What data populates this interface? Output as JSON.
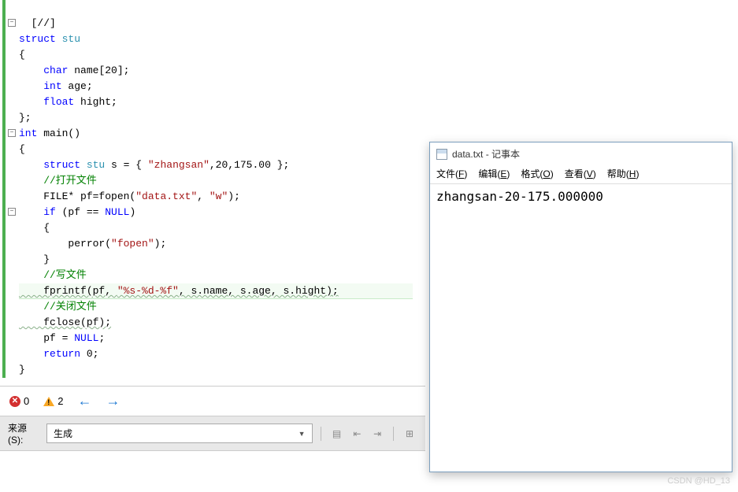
{
  "code": {
    "l1": "  [//]",
    "l2_kw": "struct",
    "l2_name": " stu",
    "l3": "{",
    "l4_a": "    ",
    "l4_kw": "char",
    "l4_b": " name[20];",
    "l5_a": "    ",
    "l5_kw": "int",
    "l5_b": " age;",
    "l6_a": "    ",
    "l6_kw": "float",
    "l6_b": " hight;",
    "l7": "};",
    "l8_kw": "int",
    "l8_b": " main()",
    "l9": "{",
    "l10_a": "    ",
    "l10_kw": "struct",
    "l10_name": " stu",
    "l10_b": " s = { ",
    "l10_str": "\"zhangsan\"",
    "l10_c": ",20,175.00 };",
    "l11_c": "    //打开文件",
    "l12_a": "    FILE* pf=fopen(",
    "l12_s1": "\"data.txt\"",
    "l12_b": ", ",
    "l12_s2": "\"w\"",
    "l12_c": ");",
    "l13_a": "    ",
    "l13_kw": "if",
    "l13_b": " (pf == ",
    "l13_n": "NULL",
    "l13_c": ")",
    "l14": "    {",
    "l15_a": "        perror(",
    "l15_s": "\"fopen\"",
    "l15_b": ");",
    "l16": "    }",
    "l17_c": "    //写文件",
    "l18_a": "    fprintf(pf, ",
    "l18_s": "\"%s-%d-%f\"",
    "l18_b": ", s.name, s.age, s.hight);",
    "l19_c": "    //关闭文件",
    "l20_a": "    fclose(pf);",
    "l21_a": "    pf = ",
    "l21_n": "NULL",
    "l21_b": ";",
    "l22_a": "    ",
    "l22_kw": "return",
    "l22_b": " 0;",
    "l23": "}"
  },
  "status": {
    "errors": "0",
    "warnings": "2",
    "nav_back": "←",
    "nav_fwd": "→"
  },
  "toolbar": {
    "source_label": "来源(S):",
    "source_value": "生成"
  },
  "notepad": {
    "title": "data.txt - 记事本",
    "menus": {
      "file": "文件",
      "file_k": "F",
      "edit": "编辑",
      "edit_k": "E",
      "format": "格式",
      "format_k": "O",
      "view": "查看",
      "view_k": "V",
      "help": "帮助",
      "help_k": "H"
    },
    "content": "zhangsan-20-175.000000"
  },
  "watermark": "CSDN @HD_13"
}
